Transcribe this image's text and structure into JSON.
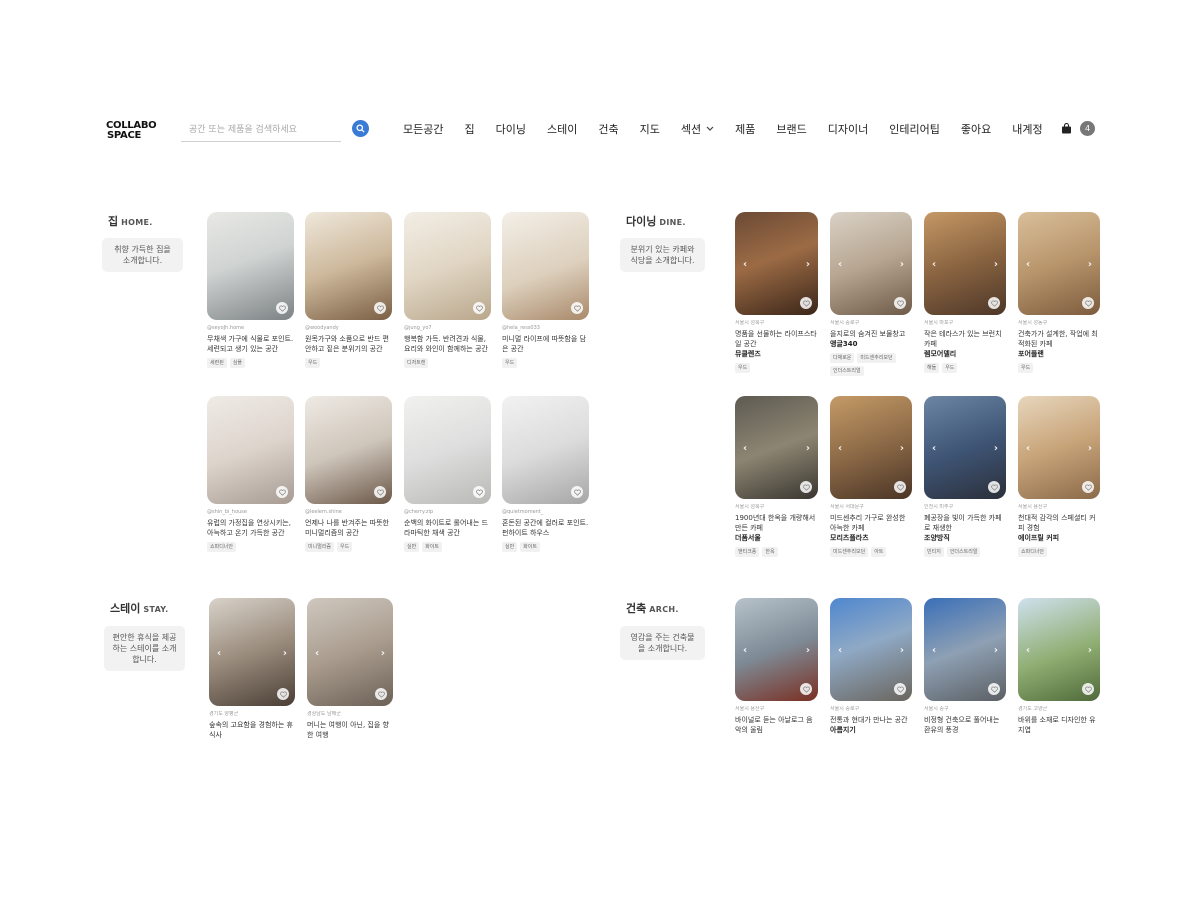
{
  "header": {
    "logo_line1": "COLLABO",
    "logo_line2": "SPACE",
    "search_placeholder": "공간 또는 제품을 검색하세요",
    "nav": [
      "모든공간",
      "집",
      "다이닝",
      "스테이",
      "건축",
      "지도",
      "섹션",
      "제품",
      "브랜드",
      "디자이너",
      "인테리어팁",
      "좋아요",
      "내계정"
    ],
    "cart_count": "4"
  },
  "sections": {
    "home": {
      "title": "집",
      "en": "HOME.",
      "desc_line1": "취향 가득한 집을",
      "desc_line2": "소개합니다.",
      "cards": [
        {
          "meta": "@seyoJh.home",
          "desc": "무채색 가구에 식물로 포인트. 세련되고 생기 있는 공간",
          "tags": [
            "세련된",
            "심플"
          ],
          "bg": "linear-gradient(160deg,#e9e9e6 0%,#cfd3d2 45%,#7d8284 100%)"
        },
        {
          "meta": "@woodyandy",
          "desc": "원목가구와 소품으로 반드 편안하고 짙은 분위기의 공간",
          "tags": [
            "우드"
          ],
          "bg": "linear-gradient(160deg,#efe8dc 0%,#cdb89b 50%,#7a5f44 100%)"
        },
        {
          "meta": "@jung_yo7",
          "desc": "행복함 가득. 반려견과 식물, 요리와 와인이 함께하는 공간",
          "tags": [
            "디저트캔"
          ],
          "bg": "linear-gradient(160deg,#f2eee6 0%,#e1d6c4 50%,#b9a78c 100%)"
        },
        {
          "meta": "@hela_ress033",
          "desc": "미니멀 라이프에 따뜻함을 담은 공간",
          "tags": [
            "우드"
          ],
          "bg": "linear-gradient(160deg,#f3efe8 0%,#ddd0bd 55%,#a9896a 100%)"
        },
        {
          "meta": "@shin_bi_house",
          "desc": "유럽의 가정집을 연상시키는, 아늑하고 온기 가득한 공간",
          "tags": [
            "쇼파디너안"
          ],
          "bg": "linear-gradient(160deg,#efebe6 0%,#ddd4cc 50%,#a79b92 100%)"
        },
        {
          "meta": "@leelem.shine",
          "desc": "언제나 나를 반겨주는 따뜻한 미니멀리즘의 공간",
          "tags": [
            "미니멀리즘",
            "우드"
          ],
          "bg": "linear-gradient(160deg,#eeeae4 0%,#cfc6bb 50%,#6b5849 100%)"
        },
        {
          "meta": "@cherry.zip",
          "desc": "순백의 화이트로 롤어내는 드라마틱한 채색 공간",
          "tags": [
            "실반",
            "화이트"
          ],
          "bg": "linear-gradient(160deg,#f1f1ef 0%,#dedede 50%,#b9b9b7 100%)"
        },
        {
          "meta": "@quietmoment_",
          "desc": "혼돈된 공간에 컬러로 포인트. 펀하이트 하우스",
          "tags": [
            "실반",
            "화이트"
          ],
          "bg": "linear-gradient(160deg,#f2f2f2 0%,#dcdcdc 50%,#a6a6a6 100%)"
        }
      ]
    },
    "dining": {
      "title": "다이닝",
      "en": "DINE.",
      "desc_line1": "분위기 있는 카페와",
      "desc_line2": "식당을 소개합니다.",
      "cards": [
        {
          "meta": "서울시 성북구",
          "desc": "명품을 선물하는 라이프스타일 공간",
          "name": "뮤클렌즈",
          "tags": [
            "우드"
          ],
          "bg": "linear-gradient(160deg,#6b4a35 0%,#9c6b45 45%,#3b2619 100%)"
        },
        {
          "meta": "서울시 중로구",
          "desc": "을지로의 숨겨진 보물창고",
          "name": "앵글340",
          "tags": [
            "다채로운",
            "미드센추리모던",
            "인더스트리얼"
          ],
          "bg": "linear-gradient(160deg,#d9d2c6 0%,#b7a591 50%,#6d5a48 100%)"
        },
        {
          "meta": "서울시 마포구",
          "desc": "작은 테라스가 있는 브런치 카페",
          "name": "렘모어델리",
          "tags": [
            "해들",
            "우드"
          ],
          "bg": "linear-gradient(160deg,#c59865 0%,#8a6441 50%,#4d3728 100%)"
        },
        {
          "meta": "서울시 성동구",
          "desc": "건축가가 설계한, 작업에 최적화된 카페",
          "name": "포어플랜",
          "tags": [
            "우드"
          ],
          "bg": "linear-gradient(160deg,#d9bf9b 0%,#b8956b 50%,#7c5c3e 100%)"
        },
        {
          "meta": "서울시 성북구",
          "desc": "1900년대 한옥을 개량해서 만든 카페",
          "name": "더폼서울",
          "tags": [
            "앤티크풍",
            "한옥"
          ],
          "bg": "linear-gradient(160deg,#5e5a52 0%,#8c8572 50%,#3a3630 100%)"
        },
        {
          "meta": "서울시 서대문구",
          "desc": "미드센추리 가구로 완성한 아늑한 카페",
          "name": "모리츠플라츠",
          "tags": [
            "미드센추리모던",
            "아트"
          ],
          "bg": "linear-gradient(160deg,#c49a66 0%,#8d6a47 50%,#4a3526 100%)"
        },
        {
          "meta": "인천시 미추구",
          "desc": "폐공장을 빛이 가득한 카페로 재생한",
          "name": "조양방직",
          "tags": [
            "빈티지",
            "인더스트리얼"
          ],
          "bg": "linear-gradient(160deg,#6d86a4 0%,#3f5677 50%,#2b2f3a 100%)"
        },
        {
          "meta": "서울시 용산구",
          "desc": "천대적 감각의 스페셜티 커피 경험",
          "name": "에이프릴 커피",
          "tags": [
            "쇼파디너안"
          ],
          "bg": "linear-gradient(160deg,#e7d6bd 0%,#c8a479 50%,#8b6a4a 100%)"
        }
      ]
    },
    "stay": {
      "title": "스테이",
      "en": "STAY.",
      "desc_line1": "편안한 휴식을 제공",
      "desc_line2": "하는 스테이를 소개",
      "desc_line3": "합니다.",
      "cards": [
        {
          "meta": "경기도 양평군",
          "desc": "숲속의 고요함을 경험하는 휴식사",
          "bg": "linear-gradient(160deg,#d8d2ca 0%,#9a8c7d 50%,#4a3e35 100%)"
        },
        {
          "meta": "경상남도 남해군",
          "desc": "머니는 여행이 아닌, 집을 향한 여행",
          "bg": "linear-gradient(160deg,#cfc8bf 0%,#aa9d8f 50%,#6c6157 100%)"
        }
      ]
    },
    "arch": {
      "title": "건축",
      "en": "ARCH.",
      "desc_line1": "영감을 주는 건축물",
      "desc_line2": "을 소개합니다.",
      "cards": [
        {
          "meta": "서울시 용산구",
          "desc": "바이널로 듣는 아날로그 음악의 울림",
          "bg": "linear-gradient(160deg,#b7c2ca 0%,#7e8b96 50%,#7a2f22 100%)"
        },
        {
          "meta": "서울시 중로구",
          "desc": "전통과 현대가 만나는 공간",
          "name": "아름지기",
          "bg": "linear-gradient(160deg,#4f87cf 0%,#8fa9c5 45%,#6a655d 100%)"
        },
        {
          "meta": "서울시 중구",
          "desc": "비정형 건축으로 풀어내는 환유의 풍경",
          "bg": "linear-gradient(160deg,#3a6fb8 0%,#8ea0b4 50%,#5b5f63 100%)"
        },
        {
          "meta": "경기도 고양군",
          "desc": "바위를 소재로 디자인한 유지엽",
          "bg": "linear-gradient(160deg,#cfe0ee 0%,#8fae72 55%,#4f6a3a 100%)"
        }
      ]
    }
  }
}
